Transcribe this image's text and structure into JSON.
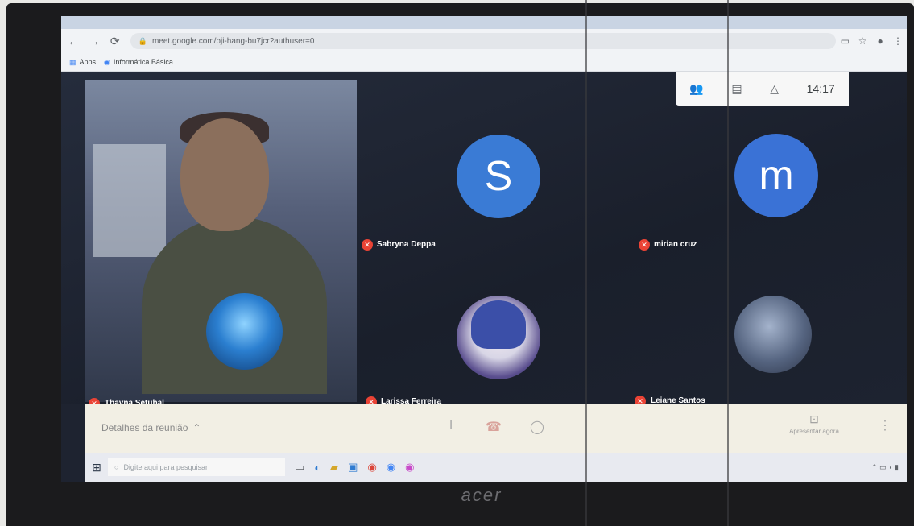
{
  "browser": {
    "url": "meet.google.com/pji-hang-bu7jcr?authuser=0",
    "bookmarks": [
      "Apps",
      "Informática Básica"
    ]
  },
  "meet": {
    "clock": "14:17",
    "participants": [
      {
        "name": "Thayna Setubal"
      },
      {
        "name": "Sabryna Deppa",
        "initial": "S"
      },
      {
        "name": "mirian cruz",
        "initial": "m"
      },
      {
        "name": "Larissa Ferreira"
      },
      {
        "name": "Leiane Santos"
      }
    ],
    "bottom": {
      "details_label": "Detalhes da reunião",
      "present_label": "Apresentar agora"
    }
  },
  "taskbar": {
    "search_placeholder": "Digite aqui para pesquisar",
    "brand": "acer"
  },
  "colors": {
    "accent": "#3a7bd5",
    "mute": "#ea4335"
  }
}
